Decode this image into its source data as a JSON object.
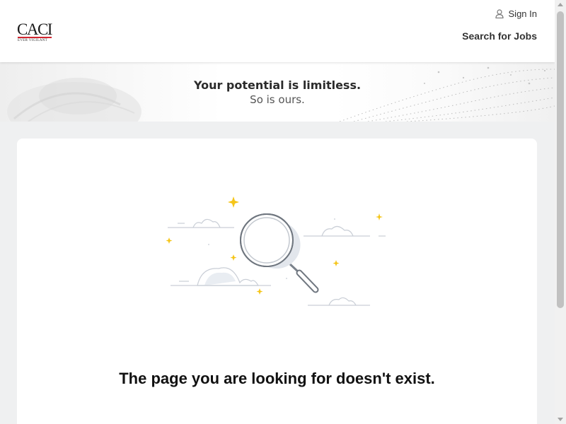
{
  "header": {
    "logo_text": "CACI",
    "logo_tagline": "EVER VIGILANT",
    "sign_in_label": "Sign In",
    "user_icon": "user-icon",
    "nav_search_jobs": "Search for Jobs"
  },
  "banner": {
    "title": "Your potential is limitless.",
    "subtitle": "So is ours."
  },
  "main": {
    "illustration_icon": "magnifying-glass-icon",
    "message": "The page you are looking for doesn't exist."
  },
  "colors": {
    "brand_red": "#d22630",
    "sparkle_yellow": "#f5c518",
    "page_background": "#eff0f1"
  }
}
